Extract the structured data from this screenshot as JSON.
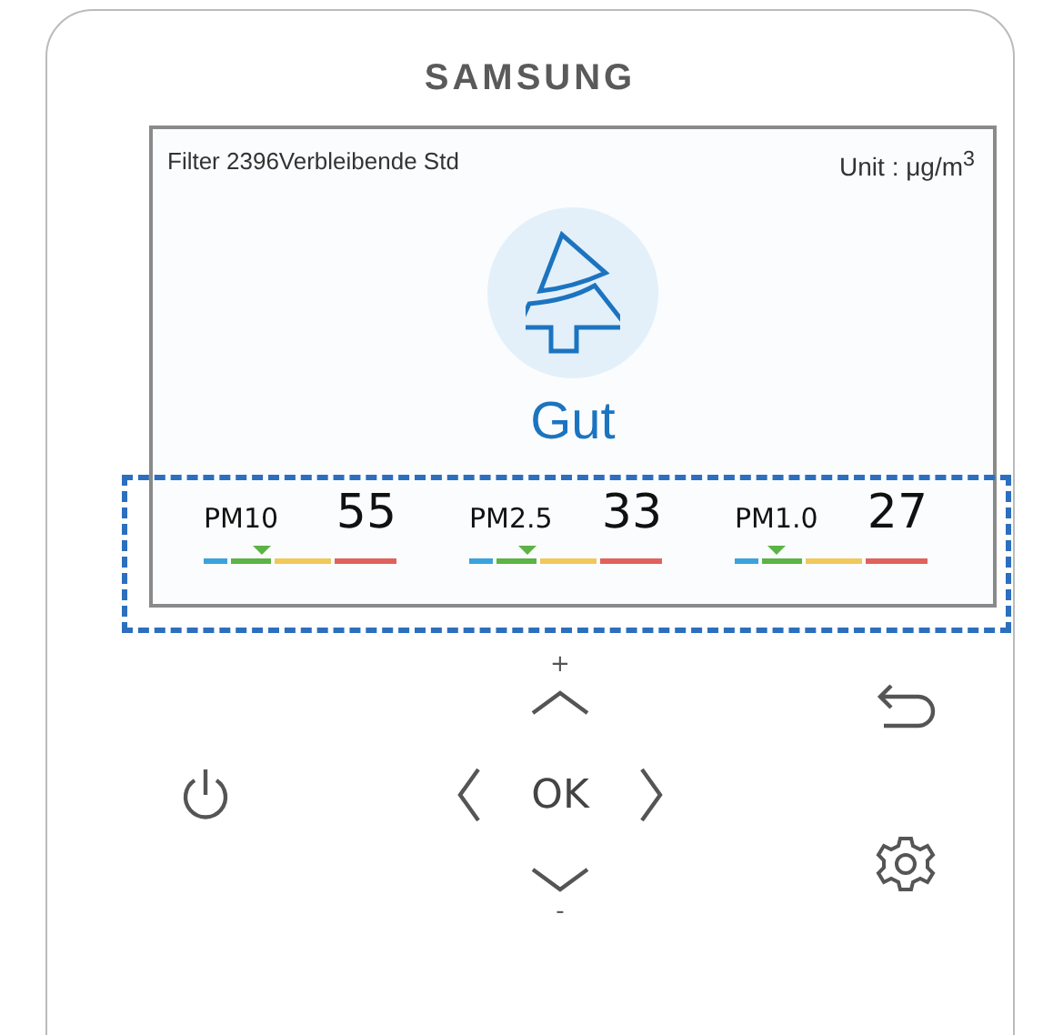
{
  "brand": "SAMSUNG",
  "screen": {
    "filter_text": "Filter 2396Verbleibende Std",
    "unit_label": "Unit : μg/m$^{3}$",
    "status": "Gut",
    "readings": [
      {
        "label": "PM10",
        "value": "55",
        "level": 0.3
      },
      {
        "label": "PM2.5",
        "value": "33",
        "level": 0.3
      },
      {
        "label": "PM1.0",
        "value": "27",
        "level": 0.22
      }
    ]
  },
  "controls": {
    "plus": "+",
    "ok": "OK",
    "minus": "-"
  }
}
